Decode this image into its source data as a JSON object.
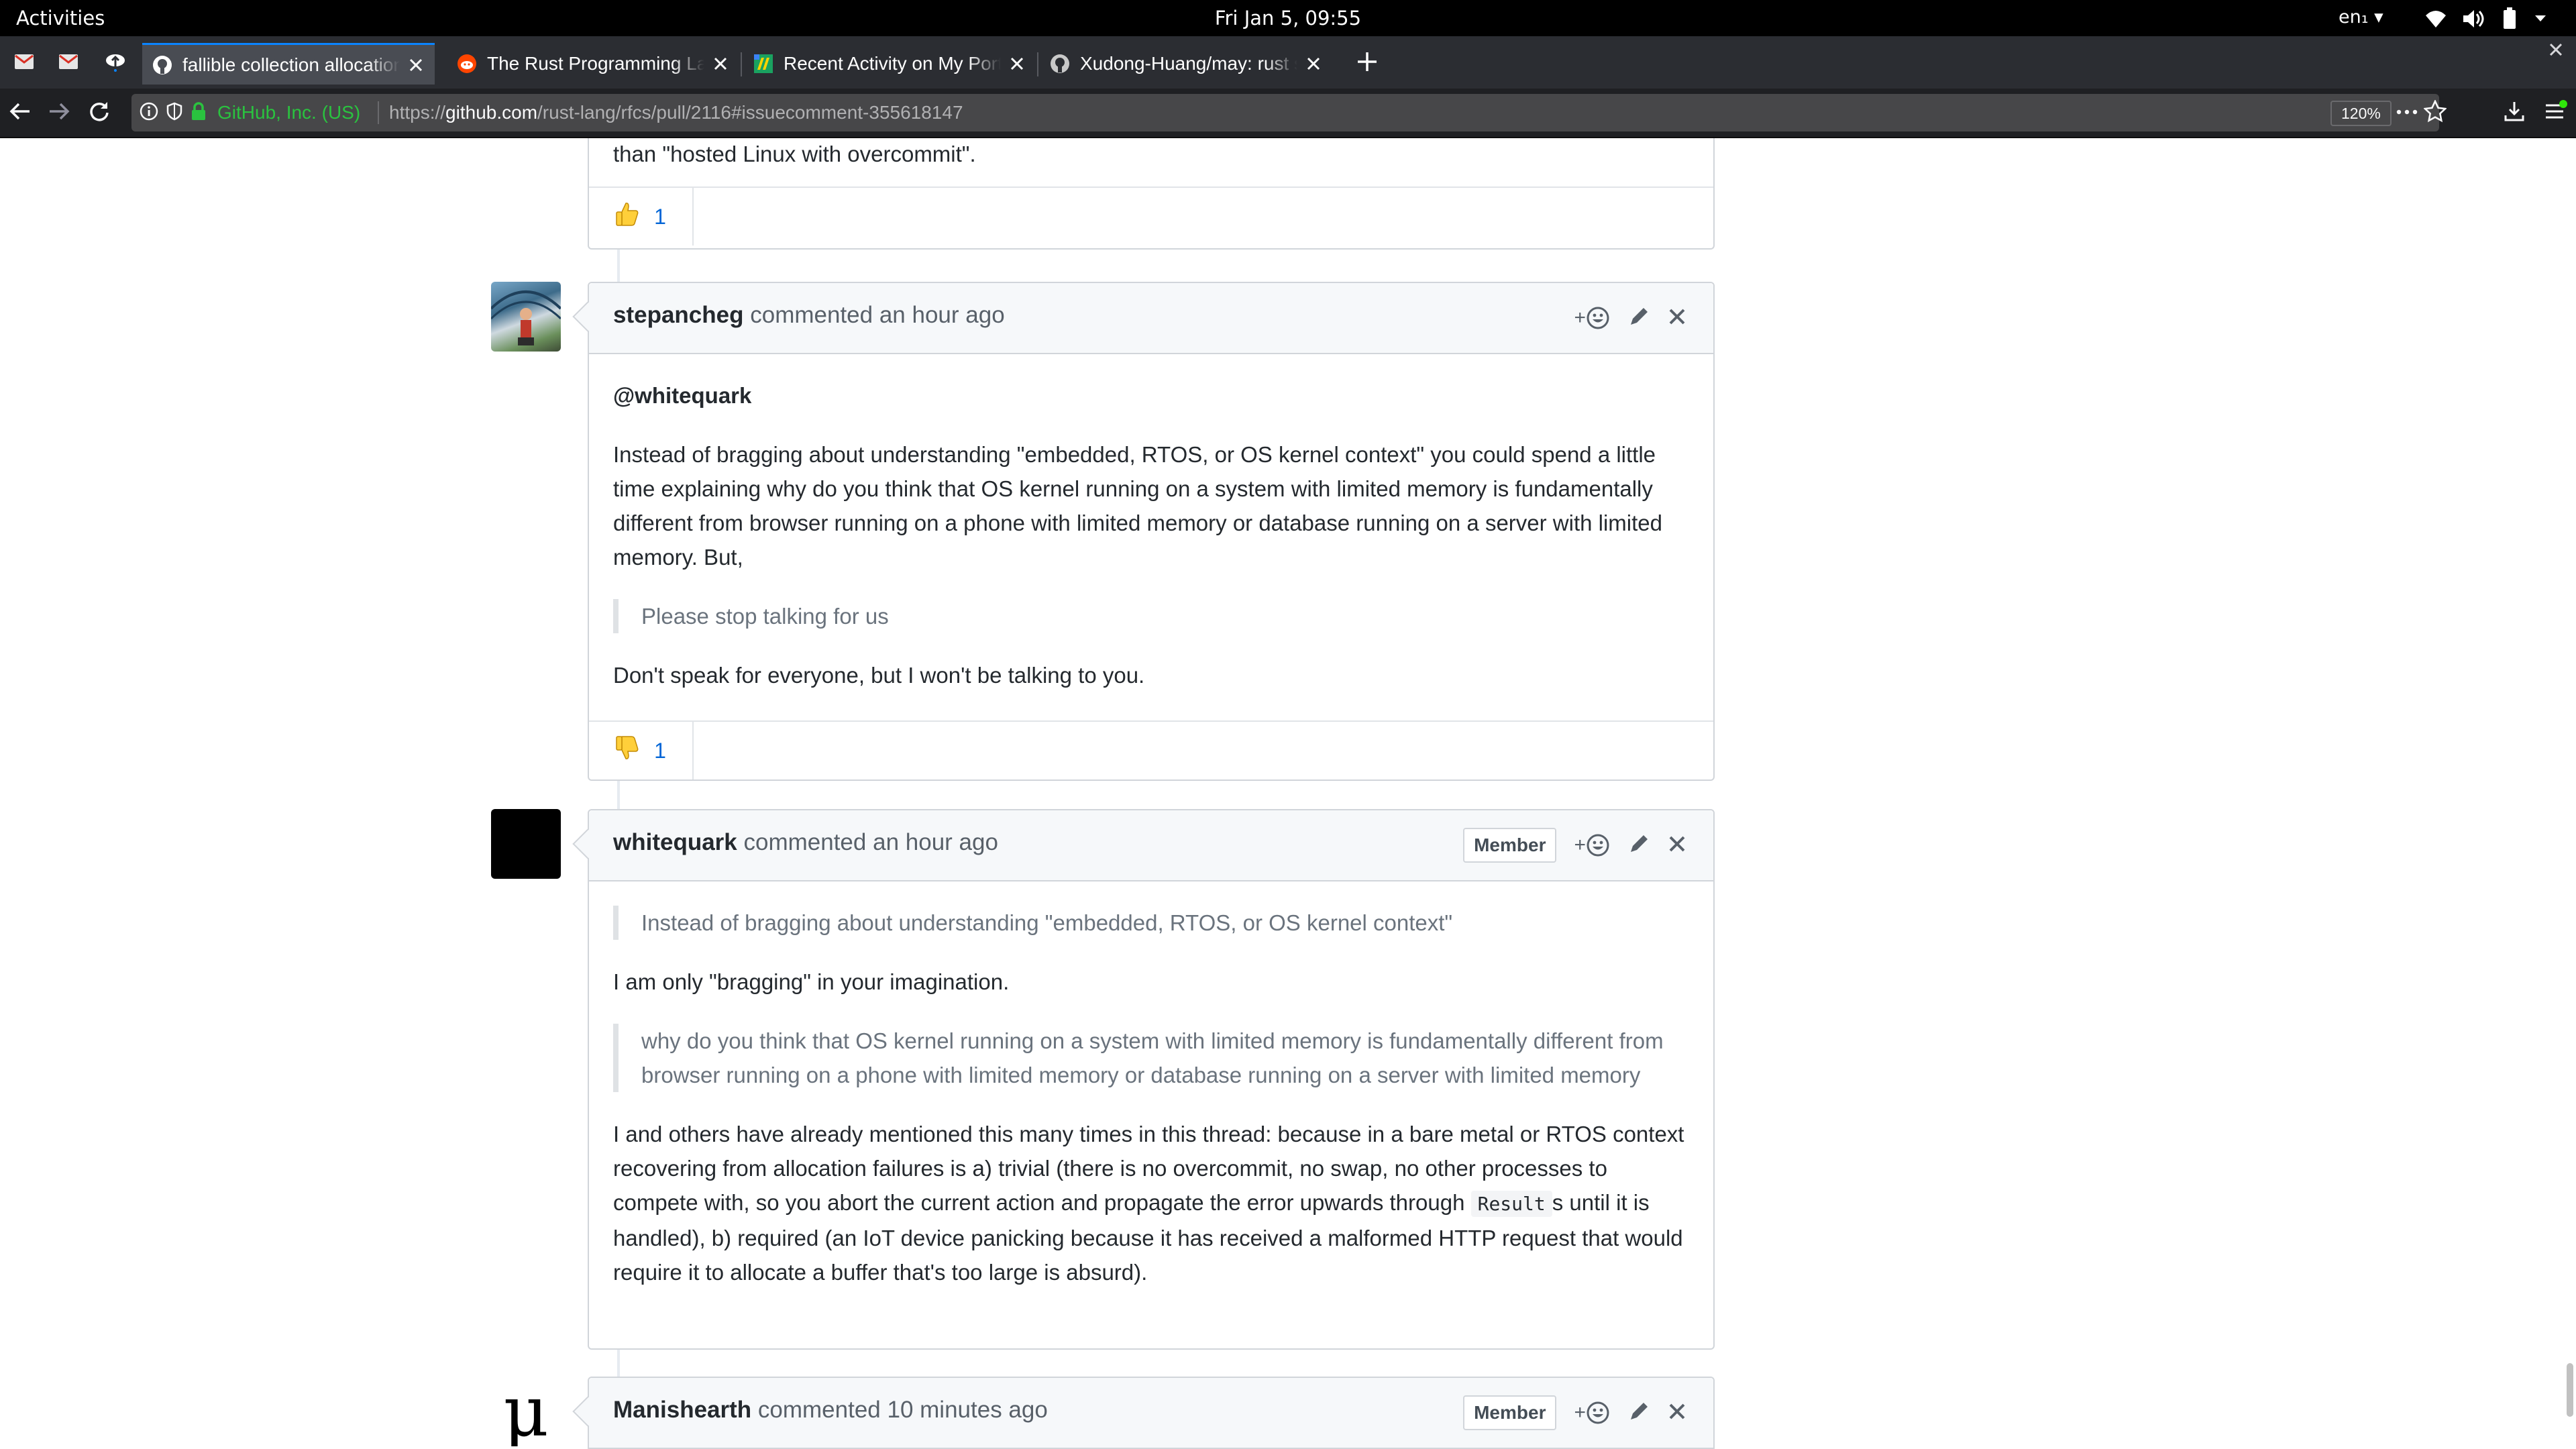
{
  "system_bar": {
    "activities": "Activities",
    "clock": "Fri Jan  5, 09:55",
    "language": "en₁"
  },
  "tabs": [
    {
      "title": "fallible collection allocation",
      "active": true
    },
    {
      "title": "The Rust Programming Language",
      "active": false
    },
    {
      "title": "Recent Activity on My Portfolio",
      "active": false
    },
    {
      "title": "Xudong-Huang/may: rust stackful coroutine",
      "active": false
    }
  ],
  "navbar": {
    "site_identity": "GitHub, Inc. (US)",
    "url_prefix": "https://",
    "url_host": "github.com",
    "url_path": "/rust-lang/rfcs/pull/2116#issuecomment-355618147",
    "zoom": "120%"
  },
  "thread": {
    "previous_tail": {
      "text_tail": "than \"hosted Linux with overcommit\".",
      "reaction": {
        "emoji": "thumbs-up",
        "count": "1"
      }
    },
    "comments": [
      {
        "author": "stepancheg",
        "action": "commented",
        "time": "an hour ago",
        "mention": "@whitequark",
        "p1": "Instead of bragging about understanding \"embedded, RTOS, or OS kernel context\" you could spend a little time explaining why do you think that OS kernel running on a system with limited memory is fundamentally different from browser running on a phone with limited memory or database running on a server with limited memory. But,",
        "quote1": "Please stop talking for us",
        "p2": "Don't speak for everyone, but I won't be talking to you.",
        "reaction": {
          "emoji": "thumbs-down",
          "count": "1"
        }
      },
      {
        "author": "whitequark",
        "action": "commented",
        "time": "an hour ago",
        "badge": "Member",
        "quote1": "Instead of bragging about understanding \"embedded, RTOS, or OS kernel context\"",
        "p1": "I am only \"bragging\" in your imagination.",
        "quote2": "why do you think that OS kernel running on a system with limited memory is fundamentally different from browser running on a phone with limited memory or database running on a server with limited memory",
        "p2_before_code": "I and others have already mentioned this many times in this thread: because in a bare metal or RTOS context recovering from allocation failures is a) trivial (there is no overcommit, no swap, no other processes to compete with, so you abort the current action and propagate the error upwards through",
        "p2_code": "Result",
        "p2_after_code": "s until it is handled), b) required (an IoT device panicking because it has received a malformed HTTP request that would require it to allocate a buffer that's too large is absurd)."
      },
      {
        "author": "Manishearth",
        "action": "commented",
        "time": "10 minutes ago",
        "badge": "Member",
        "avatar_glyph": "µ"
      }
    ]
  },
  "icons": {
    "add_reaction": "+",
    "edit": "pencil-icon",
    "delete": "close-icon"
  },
  "colors": {
    "link_blue": "#0366d6",
    "secure_green": "#2ac33f",
    "tab_accent": "#0a84ff"
  }
}
